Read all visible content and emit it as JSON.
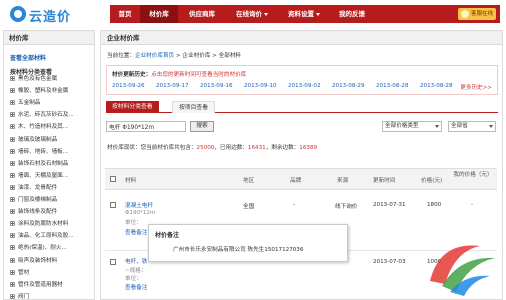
{
  "logo": {
    "text": "云造价"
  },
  "nav": {
    "items": [
      {
        "label": "首页"
      },
      {
        "label": "材价库"
      },
      {
        "label": "供应商库"
      },
      {
        "label": "在线询价"
      },
      {
        "label": "资料设置"
      },
      {
        "label": "我的反馈"
      }
    ],
    "help_label": "客服在线"
  },
  "sidebar": {
    "title": "材价库",
    "all_link": "查看全部材料",
    "category_head": "按材料分类查看",
    "items": [
      "黑色及有色金属",
      "橡胶、塑料及非金属",
      "五金制品",
      "水泥、砖瓦灰砂石及...",
      "木、竹造材料及其...",
      "玻璃及玻璃制品",
      "墙砖、地砖、墙板...",
      "装饰石材及石材制品",
      "墙面、天棚及屋面...",
      "油漆、龙骨配件",
      "门窗及楼梯制品",
      "装饰线条及配件",
      "涂料及防腐防水材料",
      "油品、化工原料及胶...",
      "绝热(保温)、耐火...",
      "吸声及装饰材料",
      "管材",
      "管件及管道用器材",
      "阀门"
    ]
  },
  "main": {
    "title": "企业材价库",
    "breadcrumb": {
      "prefix": "当前位置：",
      "home": "企业材价库首页",
      "sep1": " > ",
      "level2": "企业材价库",
      "sep2": " > ",
      "level3": "全部材料"
    },
    "update": {
      "label": "材价更新历史：",
      "hint": "点击您的更新时间可查看当时的材价库",
      "dates": [
        "2013-09-26",
        "2013-09-17",
        "2013-09-16",
        "2013-09-10",
        "2013-09-02",
        "2013-08-29",
        "2013-08-28",
        "2013-08-28"
      ],
      "more": "更多历史>>"
    },
    "tabs": [
      {
        "label": "按材料分类查看"
      },
      {
        "label": "按项目查看"
      }
    ],
    "search": {
      "value": "电杆 Φ190*12m",
      "button": "搜索",
      "price_type": "全部价格类型",
      "region": "全部省"
    },
    "stats": {
      "prefix": "材价库现状：您当前材价库共包含：",
      "total": "25000",
      "mid1": "，已用边数：",
      "used": "16431",
      "mid2": "，剩余边数：",
      "remain": "16389"
    },
    "table": {
      "headers": [
        "材料",
        "地区",
        "品牌",
        "来源",
        "更新时间",
        "价格(元)",
        "我的价格（元）"
      ],
      "rows": [
        {
          "name": "混凝土电杆",
          "spec": "Φ190*12m",
          "unit_note": "单位：",
          "note_link": "查看备注",
          "region": "全国",
          "brand": "-",
          "source": "线下询价",
          "date": "2013-07-31",
          "price": "1800",
          "my_price": "-"
        },
        {
          "name": "电杆，铁",
          "spec": "~规格：",
          "unit_note": "单位：",
          "note_link": "查看备注",
          "region": "",
          "brand": "",
          "source": "",
          "date": "2013-07-03",
          "price": "1000",
          "my_price": ""
        }
      ]
    }
  },
  "popup": {
    "title": "材价备注",
    "body": "广州市长乐永安制品有限公司 陈先生15017127036"
  }
}
